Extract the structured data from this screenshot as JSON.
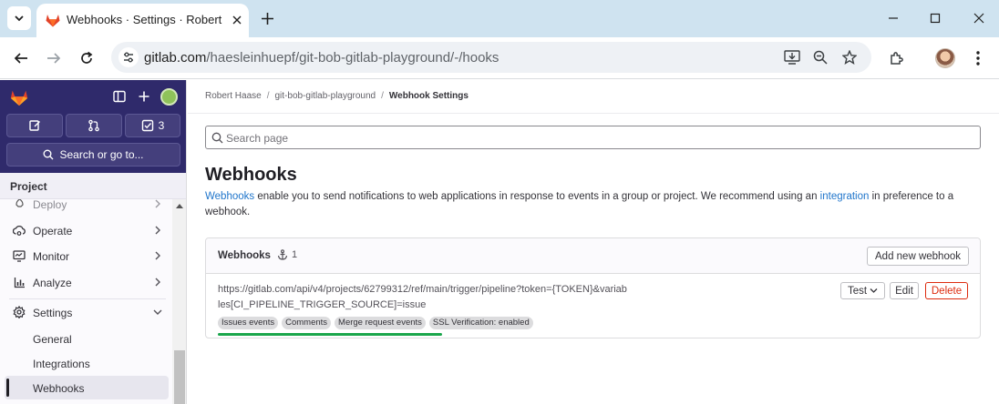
{
  "browser": {
    "tab_title": "Webhooks · Settings · Robert H",
    "url_host": "gitlab.com",
    "url_path": "/haesleinhuepf/git-bob-gitlab-playground/-/hooks"
  },
  "sidebar": {
    "todo_count": "3",
    "search_label": "Search or go to...",
    "section_label": "Project",
    "items": {
      "deploy": "Deploy",
      "operate": "Operate",
      "monitor": "Monitor",
      "analyze": "Analyze",
      "settings": "Settings",
      "general": "General",
      "integrations": "Integrations",
      "webhooks": "Webhooks"
    }
  },
  "breadcrumb": {
    "owner": "Robert Haase",
    "project": "git-bob-gitlab-playground",
    "current": "Webhook Settings"
  },
  "search": {
    "placeholder": "Search page"
  },
  "page": {
    "title": "Webhooks",
    "desc_link1": "Webhooks",
    "desc_text1": " enable you to send notifications to web applications in response to events in a group or project. We recommend using an ",
    "desc_link2": "integration",
    "desc_text2": " in preference to a webhook."
  },
  "card": {
    "title": "Webhooks",
    "count": "1",
    "add_label": "Add new webhook"
  },
  "webhook": {
    "url": "https://gitlab.com/api/v4/projects/62799312/ref/main/trigger/pipeline?token={TOKEN}&variables[CI_PIPELINE_TRIGGER_SOURCE]=issue",
    "badges": [
      "Issues events",
      "Comments",
      "Merge request events",
      "SSL Verification: enabled"
    ],
    "test_label": "Test",
    "edit_label": "Edit",
    "delete_label": "Delete"
  },
  "colors": {
    "sidebar_top": "#2f2a6b",
    "link": "#1f75cb",
    "danger": "#dd2b0e",
    "highlight": "#1aa64b"
  }
}
